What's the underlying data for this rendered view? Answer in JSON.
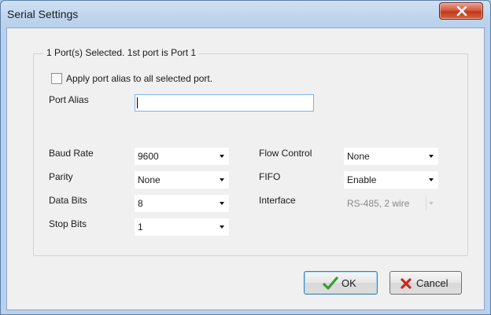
{
  "window": {
    "title": "Serial Settings"
  },
  "group": {
    "title": "1 Port(s) Selected. 1st port is Port 1"
  },
  "alias_checkbox": {
    "label": "Apply port alias to all selected port.",
    "checked": false
  },
  "port_alias": {
    "label": "Port Alias",
    "value": ""
  },
  "left_fields": [
    {
      "label": "Baud Rate",
      "value": "9600"
    },
    {
      "label": "Parity",
      "value": "None"
    },
    {
      "label": "Data Bits",
      "value": "8"
    },
    {
      "label": "Stop Bits",
      "value": "1"
    }
  ],
  "right_fields": [
    {
      "label": "Flow Control",
      "value": "None"
    },
    {
      "label": "FIFO",
      "value": "Enable"
    },
    {
      "label": "Interface",
      "value": "RS-485, 2 wire",
      "disabled": true
    }
  ],
  "buttons": {
    "ok_label": "OK",
    "cancel_label": "Cancel"
  },
  "icons": {
    "close": "close-icon",
    "ok": "checkmark-icon",
    "cancel": "x-icon"
  },
  "colors": {
    "ok_check": "#3c9b2e",
    "cancel_x": "#c8281e",
    "close_button": "#c0391c"
  }
}
